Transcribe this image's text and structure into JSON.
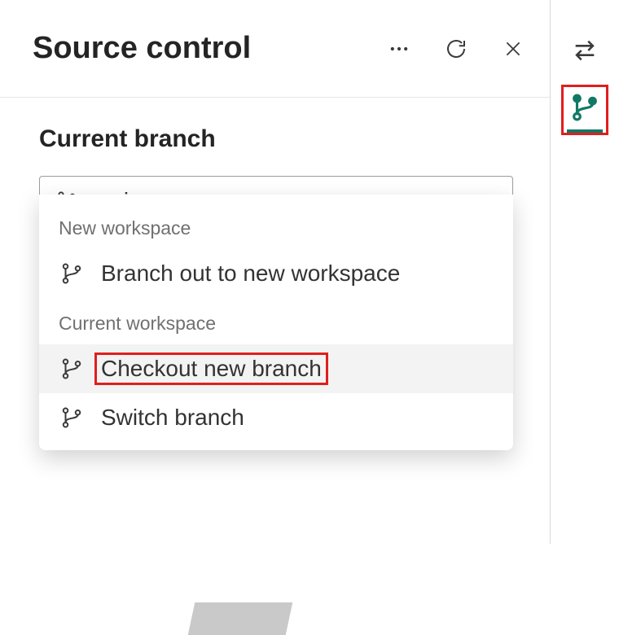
{
  "header": {
    "title": "Source control"
  },
  "section": {
    "label": "Current branch"
  },
  "dropdown": {
    "value": "main"
  },
  "menu": {
    "groups": [
      {
        "label": "New workspace",
        "items": [
          {
            "label": "Branch out to new workspace",
            "highlight": false
          }
        ]
      },
      {
        "label": "Current workspace",
        "items": [
          {
            "label": "Checkout new branch",
            "highlight": true
          },
          {
            "label": "Switch branch",
            "highlight": false
          }
        ]
      }
    ]
  },
  "colors": {
    "accent": "#117865",
    "highlight_border": "#e01e1e"
  }
}
